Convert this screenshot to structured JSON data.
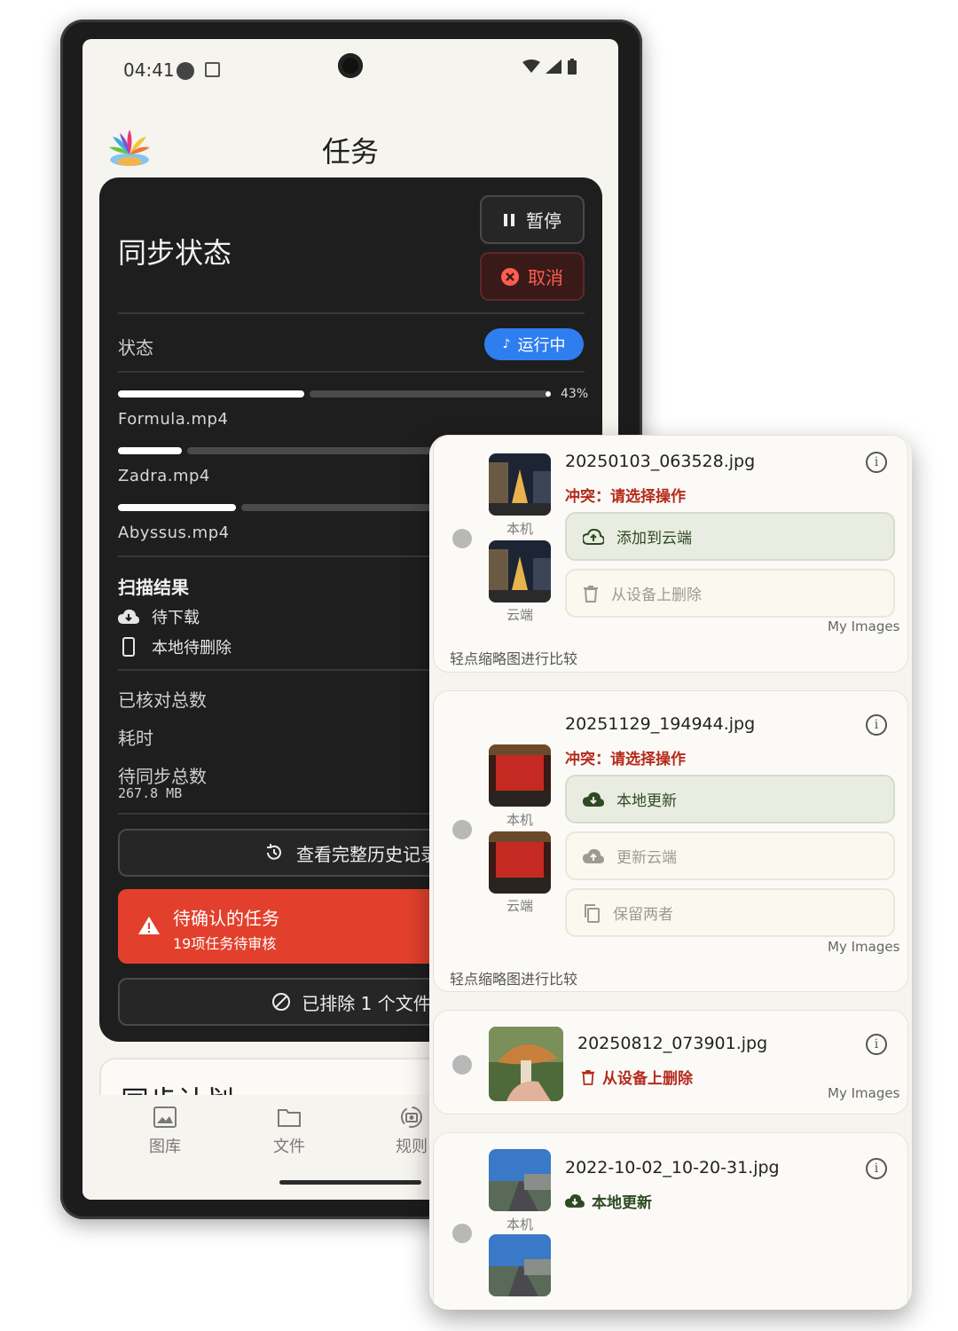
{
  "status_bar": {
    "time": "04:41"
  },
  "header": {
    "title": "任务"
  },
  "sync_card": {
    "title": "同步状态",
    "pause_label": "暂停",
    "cancel_label": "取消",
    "status_label": "状态",
    "status_badge": "运行中",
    "overall_progress": {
      "fraction": 0.43,
      "label": "43%"
    },
    "files": [
      {
        "name": "Formula.mp4",
        "progress": 0.43
      },
      {
        "name": "Zadra.mp4",
        "progress": 0.2
      },
      {
        "name": "Abyssus.mp4",
        "progress": 0.37
      }
    ],
    "scan_title": "扫描结果",
    "scan_rows": [
      "待下载",
      "本地待删除"
    ],
    "verified_label": "已核对总数",
    "elapsed_label": "耗时",
    "pending_label": "待同步总数",
    "pending_size": "267.8 MB",
    "history_button": "查看完整历史记录",
    "alert_title": "待确认的任务",
    "alert_subtitle": "19项任务待审核",
    "excluded_button": "已排除 1 个文件"
  },
  "plan_card": {
    "peek_title": "同步计划"
  },
  "bottom_nav": [
    "图库",
    "文件",
    "规则"
  ],
  "review_panel": {
    "hint": "轻点缩略图进行比较",
    "local_label": "本机",
    "cloud_label": "云端",
    "album": "My Images",
    "conflict_text": "冲突：请选择操作",
    "items": [
      {
        "filename": "20250103_063528.jpg",
        "actions": [
          "添加到云端",
          "从设备上删除"
        ]
      },
      {
        "filename": "20251129_194944.jpg",
        "actions": [
          "本地更新",
          "更新云端",
          "保留两者"
        ]
      },
      {
        "filename": "20250812_073901.jpg",
        "action": "从设备上删除"
      },
      {
        "filename": "2022-10-02_10-20-31.jpg",
        "action": "本地更新"
      }
    ]
  },
  "colors": {
    "accent_blue": "#2f7ef0",
    "alert_red": "#e2402c",
    "conflict_red": "#b52a1c",
    "card_dark": "#1e1e1e"
  }
}
